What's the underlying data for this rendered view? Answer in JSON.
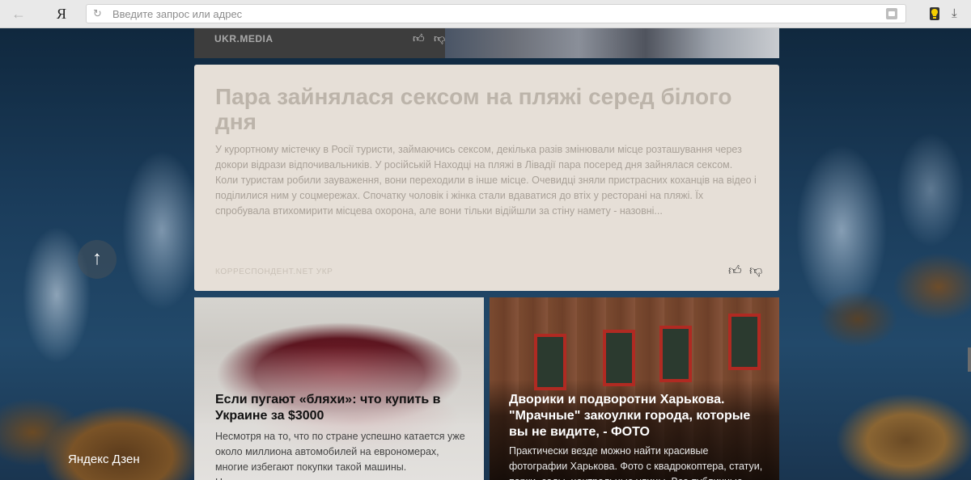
{
  "browser": {
    "logo": "Я",
    "address_placeholder": "Введите запрос или адрес"
  },
  "feed": {
    "top_card": {
      "source": "UKR.MEDIA"
    },
    "main_card": {
      "title": "Пара зайнялася сексом на пляжі серед білого дня",
      "text": "У курортному містечку в Росії туристи, займаючись сексом, декілька разів змінювали місце розташування через докори відрази відпочивальників. У російській Находці на пляжі в Лівадії пара посеред дня зайнялася сексом. Коли туристам робили зауваження, вони переходили в інше місце. Очевидці зняли пристрасних коханців на відео і поділилися ним у соцмережах. Спочатку чоловік і жінка стали вдаватися до втіх у ресторані на пляжі. Їх спробувала втихомирити місцева охорона, але вони тільки відійшли за стіну намету - назовні...",
      "source": "КОРРЕСПОНДЕНТ.NET УКР"
    },
    "car_card": {
      "title": "Если пугают «бляхи»: что купить в Украине за $3000",
      "text": "Несмотря на то, что по стране успешно катается уже около миллиона автомобилей на еврономерах, многие избегают покупки такой машины. Неудивительно: далеко не все готовы отдать свои"
    },
    "house_card": {
      "title": "Дворики и подворотни Харькова. \"Мрачные\" закоулки города, которые вы не видите, - ФОТО",
      "text": "Практически везде можно найти красивые фотографии Харькова. Фото с квадрокоптера, статуи, парки, сады, центральные улицы. Все публичные"
    }
  },
  "brand": {
    "zen_logo": "Яндекс Дзен"
  },
  "icons": {
    "back": "arrow-left-icon",
    "reload": "reload-icon",
    "lock": "lock-icon",
    "extension": "lightbulb-icon",
    "download": "download-icon",
    "like": "thumbs-up-icon",
    "dislike": "thumbs-down-icon",
    "scroll_up": "arrow-up-icon"
  },
  "colors": {
    "card_bg": "#e6dfd7",
    "browser_bar": "#e9e9e9"
  }
}
